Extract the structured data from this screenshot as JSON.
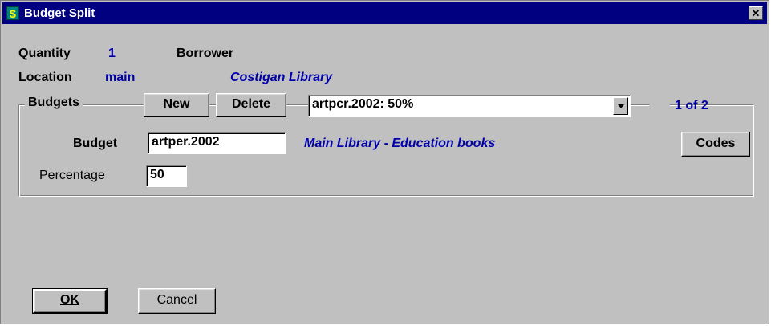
{
  "window": {
    "title": "Budget Split",
    "icon_glyph": "$",
    "close_glyph": "✕"
  },
  "info": {
    "quantity_label": "Quantity",
    "quantity_value": "1",
    "borrower_label": "Borrower",
    "location_label": "Location",
    "location_value": "main",
    "location_name": "Costigan Library"
  },
  "budgets": {
    "group_label": "Budgets",
    "new_label": "New",
    "delete_label": "Delete",
    "selected_option": "artpcr.2002: 50%",
    "position_text": "1 of 2",
    "budget_label": "Budget",
    "budget_value": "artper.2002",
    "budget_description": "Main Library - Education books",
    "codes_label": "Codes",
    "percentage_label": "Percentage",
    "percentage_value": "50"
  },
  "footer": {
    "ok_label": "OK",
    "cancel_label": "Cancel"
  },
  "colors": {
    "titlebar": "#000080",
    "face": "#c0c0c0",
    "accent_text": "#0000a8"
  }
}
